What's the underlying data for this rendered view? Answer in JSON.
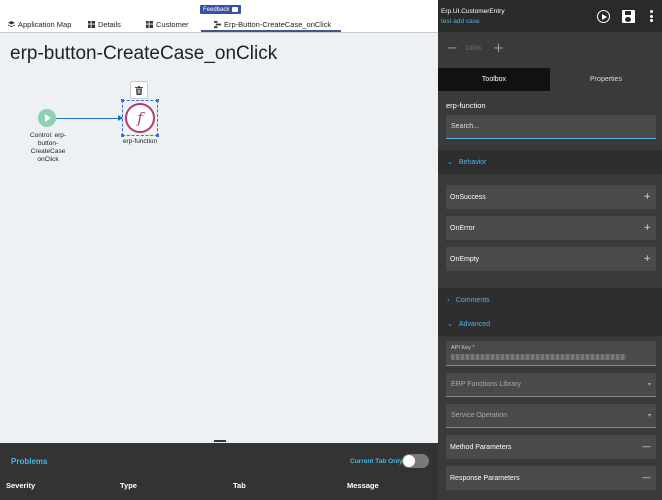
{
  "tabs": [
    {
      "label": "Application Map",
      "icon": "layers-icon"
    },
    {
      "label": "Details",
      "icon": "grid-icon"
    },
    {
      "label": "Customer",
      "icon": "grid-icon"
    },
    {
      "label": "Erp-Button-CreateCase_onClick",
      "icon": "flow-icon",
      "active": true
    }
  ],
  "feedback": {
    "label": "Feedback"
  },
  "canvas": {
    "title": "erp-button-CreateCase_onClick",
    "start_node_label": "Control: erp-button-CreateCase onClick",
    "function_node_label": "erp-function",
    "function_symbol": "f"
  },
  "problems": {
    "title": "Problems",
    "current_tab_only": "Current Tab Only",
    "toggle_on": false,
    "columns": [
      "Severity",
      "Type",
      "Tab",
      "Message"
    ]
  },
  "right_panel": {
    "app_name": "Erp.UI.CustomerEntry",
    "case_link": "test add case",
    "zoom_minus": "−",
    "zoom_level": "100%",
    "zoom_plus": "+",
    "tab_toolbox": "Toolbox",
    "tab_properties": "Properties",
    "function_title": "erp-function",
    "search_placeholder": "Search...",
    "behavior": {
      "label": "Behavior",
      "items": [
        "OnSuccess",
        "OnError",
        "OnEmpty"
      ],
      "item_action": "+"
    },
    "comments": {
      "label": "Comments"
    },
    "advanced": {
      "label": "Advanced",
      "api_key_label": "API Key *",
      "erp_functions_library": "ERP Functions Library",
      "service_operation": "Service Operation",
      "method_parameters": "Method Parameters",
      "response_parameters": "Response Parameters",
      "row_action": "—"
    }
  },
  "colors": {
    "accent": "#4cb4e8",
    "tab_underline": "#3b5a84",
    "feedback_bg": "#3552a5",
    "start_node": "#8fcfb2",
    "function_node": "#b23a72",
    "connector": "#1a73c8",
    "panel_bg": "#3a3a3a",
    "canvas_bg": "#eef1f4"
  }
}
